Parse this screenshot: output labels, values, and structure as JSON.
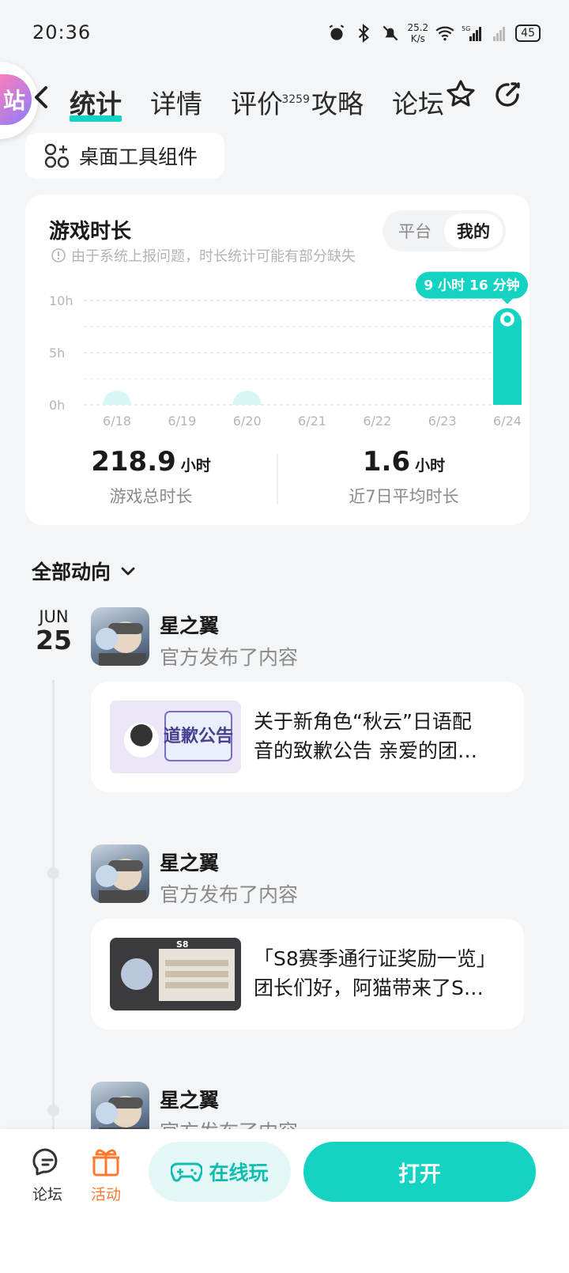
{
  "status_bar": {
    "time": "20:36",
    "net_speed_value": "25.2",
    "net_speed_unit": "K/s",
    "network": "5G",
    "battery": "45"
  },
  "nav": {
    "tabs": [
      {
        "label": "统计",
        "active": true
      },
      {
        "label": "详情"
      },
      {
        "label": "评价",
        "count": "3259"
      },
      {
        "label": "攻略"
      },
      {
        "label": "论坛"
      }
    ],
    "icons": [
      "back-icon",
      "star-icon",
      "share-icon"
    ]
  },
  "widget_chip": {
    "label": "桌面工具组件"
  },
  "stats": {
    "title": "游戏时长",
    "note": "由于系统上报问题，时长统计可能有部分缺失",
    "segment": {
      "options": [
        "平台",
        "我的"
      ],
      "selected": "我的"
    },
    "tooltip": "9 小时 16 分钟",
    "total": {
      "value": "218.9",
      "unit": "小时",
      "label": "游戏总时长"
    },
    "average": {
      "value": "1.6",
      "unit": "小时",
      "label": "近7日平均时长"
    }
  },
  "chart_data": {
    "type": "bar",
    "categories": [
      "6/18",
      "6/19",
      "6/20",
      "6/21",
      "6/22",
      "6/23",
      "6/24"
    ],
    "values": [
      0.5,
      0,
      1.0,
      0,
      0,
      0,
      9.27
    ],
    "y_ticks": [
      "0h",
      "5h",
      "10h"
    ],
    "ylim": [
      0,
      10
    ],
    "grid": true,
    "highlight_index": 6,
    "bar_color": "#15d3c3",
    "bar_color_light": "#d8f6f3"
  },
  "feed": {
    "filter_label": "全部动向",
    "date": {
      "month": "JUN",
      "day": "25"
    },
    "posts": [
      {
        "name": "星之翼",
        "action": "官方发布了内容",
        "line1": "关于新角色“秋云”日语配",
        "line2": "音的致歉公告 亲爱的团…",
        "thumb_text": "道歉公告"
      },
      {
        "name": "星之翼",
        "action": "官方发布了内容",
        "line1": "「S8赛季通行证奖励一览」",
        "line2": "团长们好，阿猫带来了S…",
        "thumb_text": "S8"
      },
      {
        "name": "星之翼",
        "action": "官方发布了内容"
      }
    ]
  },
  "bottom_bar": {
    "forum": "论坛",
    "activity": "活动",
    "play_online": "在线玩",
    "open": "打开",
    "accent": "#15d3c3",
    "activity_color": "#ff7a2e"
  },
  "float_badge": {
    "label": "站"
  }
}
